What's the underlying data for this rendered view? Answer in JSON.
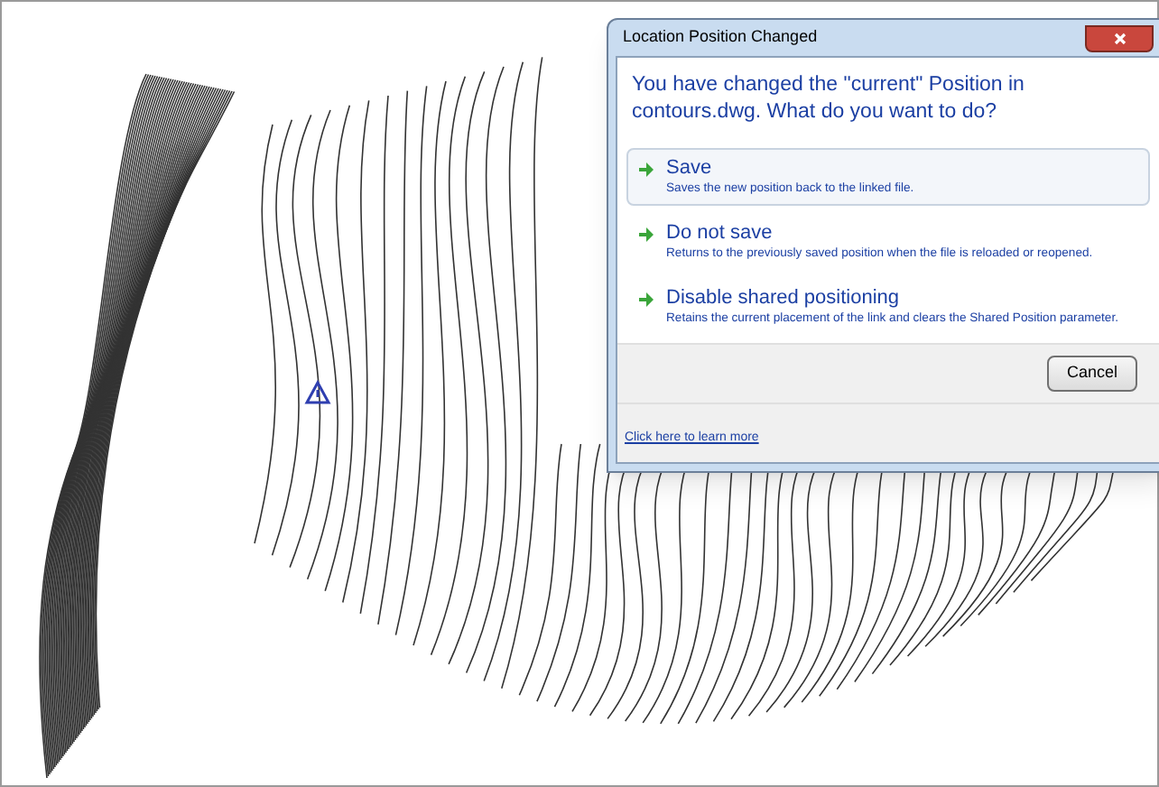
{
  "dialog": {
    "title": "Location Position Changed",
    "question": "You have changed the \"current\" Position in contours.dwg.  What do you want to do?",
    "options": [
      {
        "label": "Save",
        "description": "Saves the new position back to the linked file.",
        "selected": true
      },
      {
        "label": "Do not save",
        "description": "Returns to the previously saved position when the file is reloaded or reopened.",
        "selected": false
      },
      {
        "label": "Disable shared positioning",
        "description": "Retains the current placement of the link and clears the Shared Position parameter.",
        "selected": false
      }
    ],
    "cancel_button": "Cancel",
    "learn_more_link": "Click here to learn more"
  }
}
